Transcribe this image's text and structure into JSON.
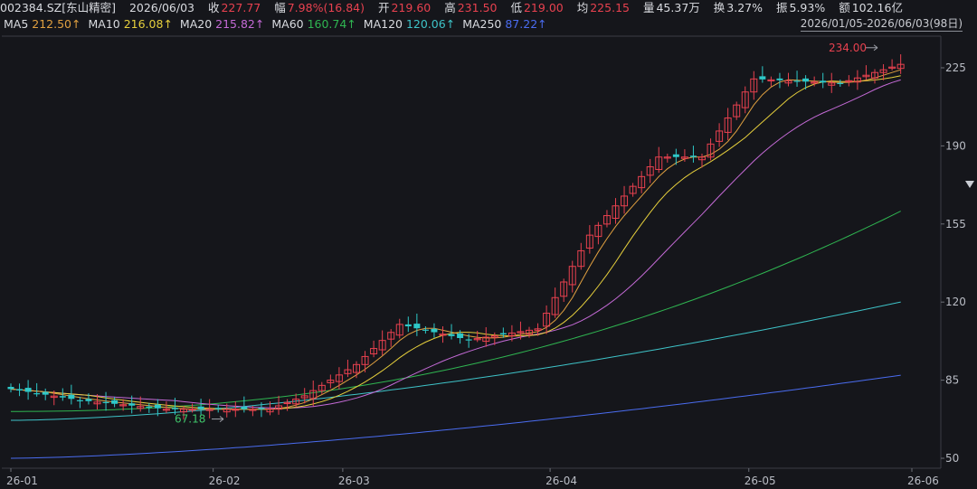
{
  "header": {
    "code": "002384.SZ[东山精密]",
    "date": "2026/06/03",
    "close_label": "收",
    "close": "227.77",
    "chg_label": "幅",
    "chg": "7.98%(16.84)",
    "open_label": "开",
    "open": "219.60",
    "high_label": "高",
    "high": "231.50",
    "low_label": "低",
    "low": "219.00",
    "avg_label": "均",
    "avg": "225.15",
    "vol_label": "量",
    "vol": "45.37万",
    "turnover_label": "换",
    "turnover": "3.27%",
    "amp_label": "振",
    "amp": "5.93%",
    "amount_label": "额",
    "amount": "102.16亿"
  },
  "ma_legend": [
    {
      "name": "MA5",
      "value": "212.50↑",
      "color": "#e0a040"
    },
    {
      "name": "MA10",
      "value": "216.08↑",
      "color": "#e6cf3c"
    },
    {
      "name": "MA20",
      "value": "215.82↑",
      "color": "#c46ad6"
    },
    {
      "name": "MA60",
      "value": "160.74↑",
      "color": "#2fb551"
    },
    {
      "name": "MA120",
      "value": "120.06↑",
      "color": "#3ec3c8"
    },
    {
      "name": "MA250",
      "value": "87.22↑",
      "color": "#4a6cf0"
    }
  ],
  "date_range": "2026/01/05-2026/06/03(98日)",
  "chart_data": {
    "type": "candlestick",
    "ylim": [
      45,
      240
    ],
    "y_ticks": [
      225,
      190,
      155,
      120,
      85,
      50
    ],
    "x_ticks": [
      {
        "label": "26-01",
        "index": 0
      },
      {
        "label": "26-02",
        "index": 23
      },
      {
        "label": "26-03",
        "index": 38
      },
      {
        "label": "26-04",
        "index": 62
      },
      {
        "label": "26-05",
        "index": 85
      },
      {
        "label": "26-06",
        "index": 106
      }
    ],
    "annotations": [
      {
        "text": "234.00",
        "value": 234.0,
        "index": 97,
        "color": "#e8414f"
      },
      {
        "text": "67.18",
        "value": 67.18,
        "index": 25,
        "color": "#3fc46a"
      }
    ],
    "ma_series": {
      "MA60": {
        "color": "#2fb551",
        "start": 71,
        "end": 160.74
      },
      "MA120": {
        "color": "#3ec3c8",
        "start": 67,
        "end": 120.06
      },
      "MA250": {
        "color": "#4a6cf0",
        "start": 50,
        "end": 87.22
      }
    }
  }
}
